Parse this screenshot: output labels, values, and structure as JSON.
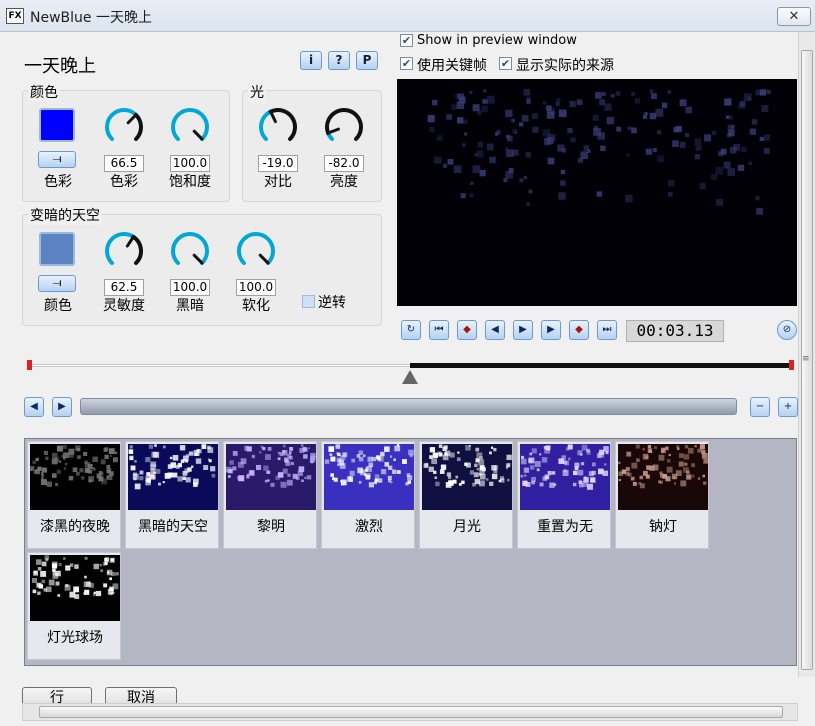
{
  "window": {
    "icon_text": "FX",
    "title": "NewBlue 一天晚上",
    "close_glyph": "✕"
  },
  "effect": {
    "title": "一天晚上",
    "info_btn": "i",
    "help_btn": "?",
    "preset_btn": "P"
  },
  "color_group": {
    "label": "颜色",
    "swatch_color": "#0000ff",
    "swatch_label": "色彩",
    "hue": {
      "value": "66.5",
      "label": "色彩",
      "level": 0.665
    },
    "saturation": {
      "value": "100.0",
      "label": "饱和度",
      "level": 1.0
    }
  },
  "light_group": {
    "label": "光",
    "contrast": {
      "value": "-19.0",
      "label": "对比",
      "level": 0.405
    },
    "brightness": {
      "value": "-82.0",
      "label": "亮度",
      "level": 0.09
    }
  },
  "sky_group": {
    "label": "变暗的天空",
    "swatch_color": "#5b82c2",
    "swatch_label": "颜色",
    "sensitivity": {
      "value": "62.5",
      "label": "灵敏度",
      "level": 0.625
    },
    "darkness": {
      "value": "100.0",
      "label": "黑暗",
      "level": 1.0
    },
    "softness": {
      "value": "100.0",
      "label": "软化",
      "level": 1.0
    },
    "invert_label": "逆转"
  },
  "options": {
    "show_preview": {
      "label": "Show in preview window",
      "checked": true
    },
    "use_keyframes": {
      "label": "使用关键帧",
      "checked": true
    },
    "show_source": {
      "label": "显示实际的来源",
      "checked": true
    }
  },
  "transport": {
    "timecode": "00:03.13"
  },
  "timeline": {
    "playhead": 0.5
  },
  "presets": [
    {
      "name": "漆黑的夜晚"
    },
    {
      "name": "黑暗的天空"
    },
    {
      "name": "黎明"
    },
    {
      "name": "激烈"
    },
    {
      "name": "月光"
    },
    {
      "name": "重置为无"
    },
    {
      "name": "钠灯"
    },
    {
      "name": "灯光球场"
    }
  ],
  "footer": {
    "ok_label": "行",
    "cancel_label": "取消"
  },
  "colors": {
    "accent": "#00a8d8",
    "knob_dark": "#111111"
  }
}
